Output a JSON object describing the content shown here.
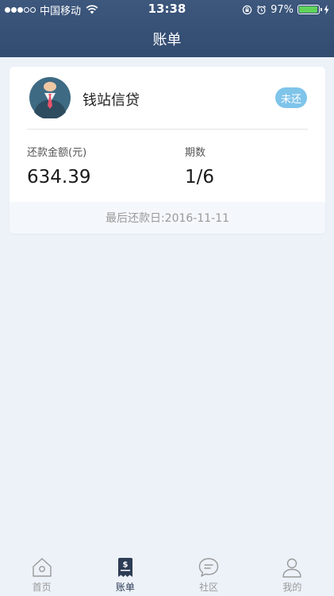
{
  "status_bar": {
    "carrier": "中国移动",
    "time": "13:38",
    "battery_percent": "97%",
    "battery_level": 0.97,
    "signal_bars_filled": 3,
    "signal_bars_total": 5
  },
  "header": {
    "title": "账单"
  },
  "bill": {
    "lender": "钱站信贷",
    "status_badge": "未还",
    "amount_label": "还款金额(元)",
    "amount_value": "634.39",
    "period_label": "期数",
    "period_value": "1/6",
    "due_date": "最后还款日:2016-11-11"
  },
  "tabs": [
    {
      "label": "首页",
      "icon": "home-icon",
      "active": false
    },
    {
      "label": "账单",
      "icon": "bill-icon",
      "active": true
    },
    {
      "label": "社区",
      "icon": "chat-icon",
      "active": false
    },
    {
      "label": "我的",
      "icon": "user-icon",
      "active": false
    }
  ],
  "colors": {
    "header_bg": "#3a5479",
    "page_bg": "#edf2f9",
    "badge_bg": "#7fc4ea",
    "tab_active": "#2d3d56",
    "tab_inactive": "#999999"
  }
}
